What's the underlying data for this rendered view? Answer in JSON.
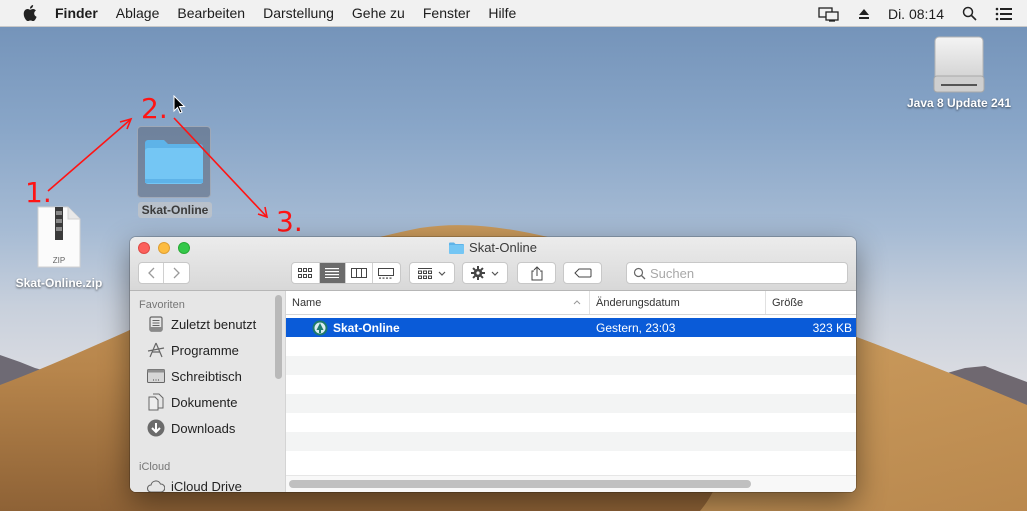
{
  "menubar": {
    "app_name": "Finder",
    "items": [
      "Ablage",
      "Bearbeiten",
      "Darstellung",
      "Gehe zu",
      "Fenster",
      "Hilfe"
    ],
    "clock": "Di. 08:14",
    "icons": [
      "apple-logo",
      "display-mirroring-icon",
      "eject-icon",
      "spotlight-search-icon",
      "notification-center-icon"
    ]
  },
  "desktop": {
    "drive_label": "Java 8 Update 241",
    "zip_label": "Skat-Online.zip",
    "zip_badge": "ZIP",
    "folder_label": "Skat-Online",
    "annotations": [
      "1.",
      "2.",
      "3."
    ],
    "annotation_color": "#ff1414"
  },
  "window": {
    "title": "Skat-Online",
    "search_placeholder": "Suchen",
    "toolbar": {
      "back": "back-icon",
      "forward": "forward-icon",
      "views": [
        "icon-view",
        "list-view",
        "column-view",
        "gallery-view"
      ],
      "active_view": "list-view",
      "group": "group-icon",
      "action": "gear-icon",
      "share": "share-icon",
      "tags": "tag-icon"
    },
    "sidebar": {
      "sections": [
        {
          "title": "Favoriten",
          "items": [
            {
              "label": "Zuletzt benutzt",
              "icon": "recents-icon"
            },
            {
              "label": "Programme",
              "icon": "applications-icon"
            },
            {
              "label": "Schreibtisch",
              "icon": "desktop-icon"
            },
            {
              "label": "Dokumente",
              "icon": "documents-icon"
            },
            {
              "label": "Downloads",
              "icon": "downloads-icon"
            }
          ]
        },
        {
          "title": "iCloud",
          "items": [
            {
              "label": "iCloud Drive",
              "icon": "cloud-icon"
            }
          ]
        }
      ]
    },
    "columns": {
      "name": "Name",
      "date": "Änderungsdatum",
      "size": "Größe"
    },
    "files": [
      {
        "name": "Skat-Online",
        "date": "Gestern, 23:03",
        "size": "323 KB",
        "selected": true
      }
    ],
    "selection_color": "#0a5bd8"
  }
}
